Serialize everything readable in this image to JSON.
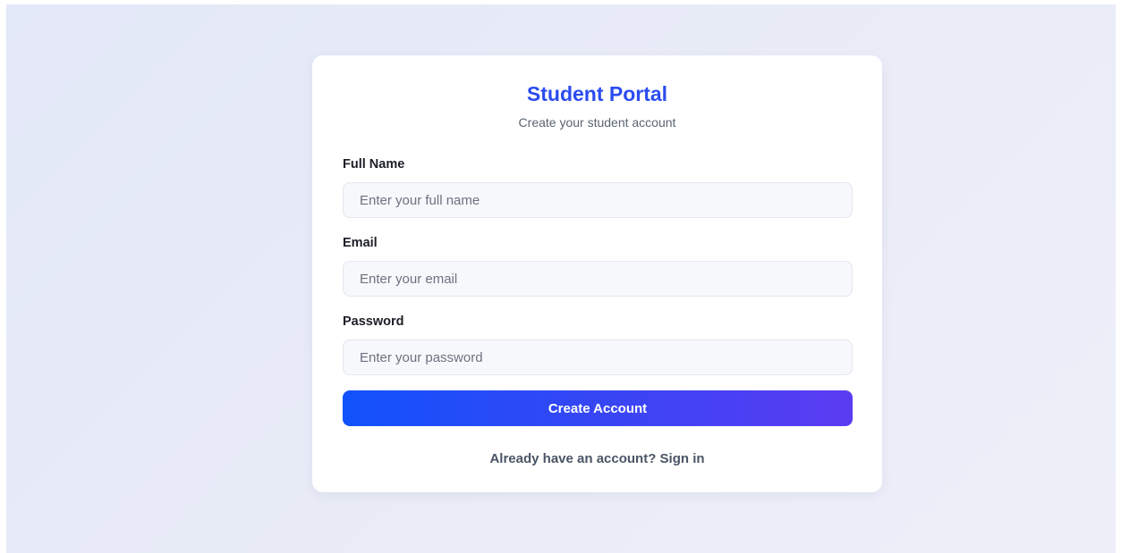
{
  "form": {
    "title": "Student Portal",
    "subtitle": "Create your student account",
    "fields": [
      {
        "label": "Full Name",
        "placeholder": "Enter your full name",
        "value": ""
      },
      {
        "label": "Email",
        "placeholder": "Enter your email",
        "value": ""
      },
      {
        "label": "Password",
        "placeholder": "Enter your password",
        "value": ""
      }
    ],
    "submit_label": "Create Account",
    "signin_text": "Already have an account? Sign in"
  },
  "colors": {
    "title": "#2b4cf0",
    "button_gradient_start": "#1152fb",
    "button_gradient_end": "#5b3bf2",
    "background": "#e6eaf8"
  }
}
